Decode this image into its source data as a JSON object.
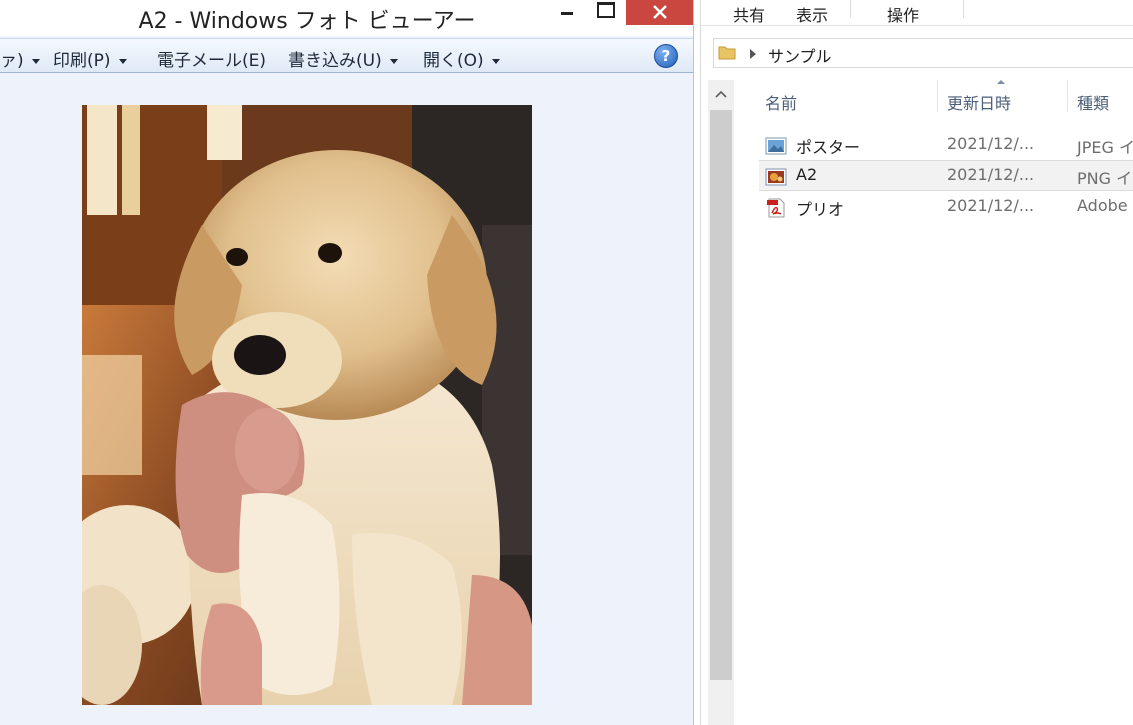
{
  "viewer": {
    "title": "A2 - Windows フォト ビューアー",
    "toolbar": {
      "partial_label": "ァ)",
      "print_label": "印刷(P)",
      "email_label": "電子メール(E)",
      "burn_label": "書き込み(U)",
      "open_label": "開く(O)",
      "help_label": "?"
    },
    "photo": {
      "subject": "golden retriever puppy held by a hand",
      "icon": "photo-image"
    },
    "window_buttons": [
      "minimize-icon",
      "maximize-icon",
      "close-icon"
    ],
    "colors": {
      "close_button": "#c9473f",
      "background": "#eef3fb"
    }
  },
  "explorer": {
    "ribbon_tabs": [
      "共有",
      "表示",
      "操作"
    ],
    "address": {
      "folder": "サンプル"
    },
    "columns": [
      "名前",
      "更新日時",
      "種類"
    ],
    "files": [
      {
        "name": "ポスター",
        "date": "2021/12/...",
        "type": "JPEG イ",
        "icon": "jpeg-image-icon"
      },
      {
        "name": "A2",
        "date": "2021/12/...",
        "type": "PNG イ",
        "icon": "png-image-icon",
        "selected": true
      },
      {
        "name": "プリオ",
        "date": "2021/12/...",
        "type": "Adobe",
        "icon": "pdf-file-icon"
      }
    ]
  }
}
